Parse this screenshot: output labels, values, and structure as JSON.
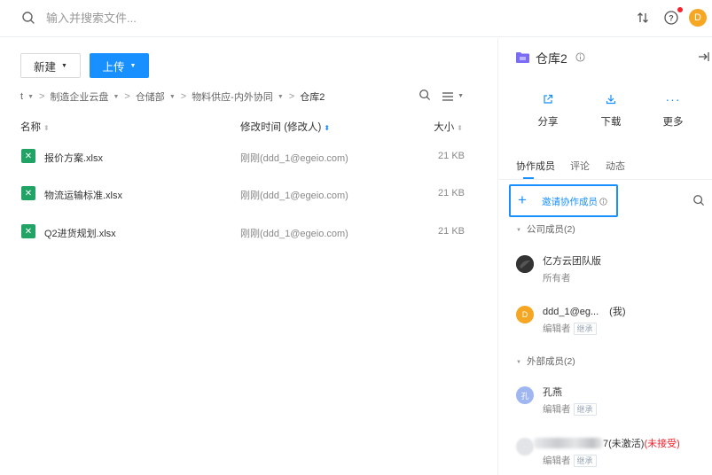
{
  "topbar": {
    "search_placeholder": "输入并搜索文件...",
    "icons": [
      "search-icon",
      "transfer-icon",
      "help-icon",
      "notification-dot"
    ],
    "user_initial": "D",
    "accent": "#1890ff"
  },
  "toolbar": {
    "new_label": "新建",
    "upload_label": "上传"
  },
  "breadcrumb": {
    "items": [
      "t",
      "制造企业云盘",
      "仓储部",
      "物料供应-内外协同"
    ],
    "current": "仓库2"
  },
  "file_list": {
    "columns": {
      "name": "名称",
      "modified": "修改时间 (修改人)",
      "size": "大小"
    },
    "rows": [
      {
        "name": "报价方案.xlsx",
        "modified": "刚刚(ddd_1@egeio.com)",
        "size": "21 KB"
      },
      {
        "name": "物流运输标准.xlsx",
        "modified": "刚刚(ddd_1@egeio.com)",
        "size": "21 KB"
      },
      {
        "name": "Q2进货规划.xlsx",
        "modified": "刚刚(ddd_1@egeio.com)",
        "size": "21 KB"
      }
    ]
  },
  "details": {
    "title": "仓库2",
    "actions": {
      "share": "分享",
      "download": "下载",
      "more": "更多"
    },
    "tabs": {
      "members": "协作成员",
      "comments": "评论",
      "activity": "动态"
    },
    "invite_label": "邀请协作成员",
    "company_group": "公司成员(2)",
    "external_group": "外部成员(2)",
    "members": [
      {
        "name": "亿方云团队版",
        "role": "所有者",
        "inherit": ""
      },
      {
        "name": "ddd_1@eg...",
        "me": "(我)",
        "role": "编辑者",
        "inherit": "继承",
        "initial": "D"
      },
      {
        "name": "孔燕",
        "role": "编辑者",
        "inherit": "继承",
        "initial": "孔"
      },
      {
        "name_suffix": "7(未激活)",
        "status": "(未接受)",
        "role": "编辑者",
        "inherit": "继承"
      }
    ]
  }
}
